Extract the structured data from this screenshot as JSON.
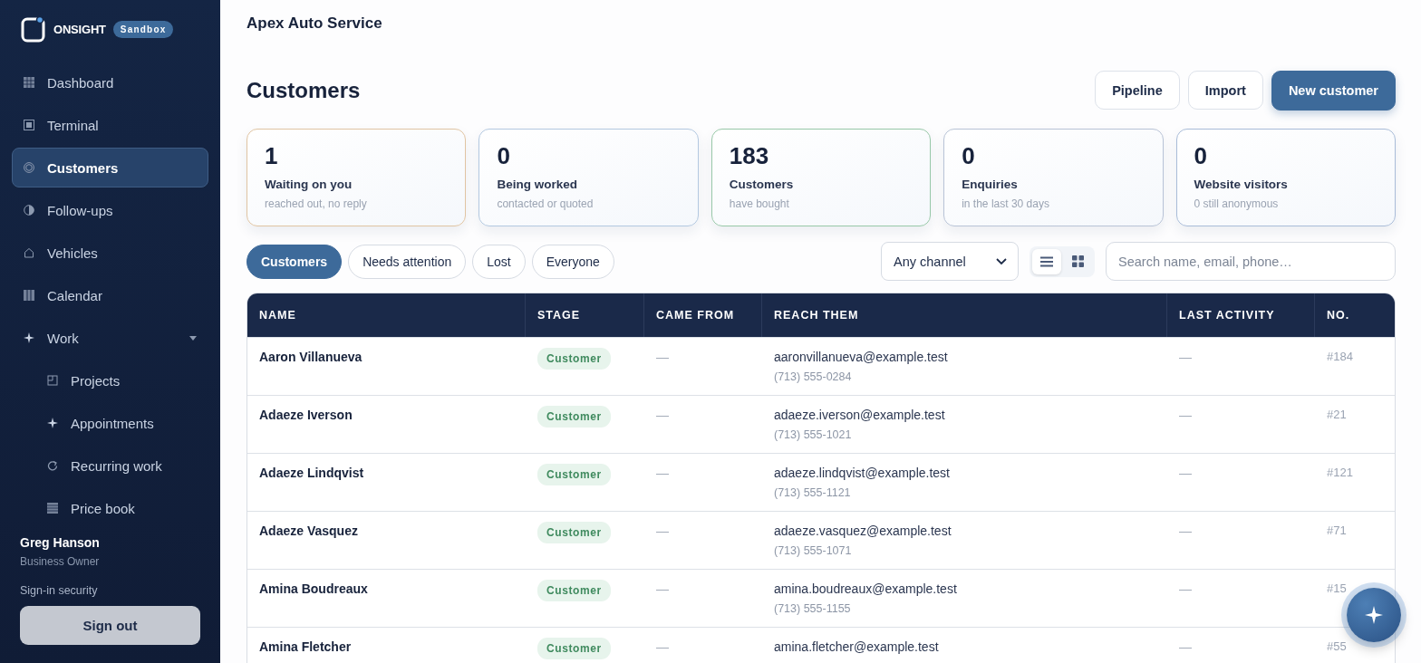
{
  "sidebar": {
    "logo": "ONSIGHT",
    "badge": "Sandbox",
    "items": [
      {
        "label": "Dashboard",
        "kind": "grid",
        "selected": false
      },
      {
        "label": "Terminal",
        "kind": "square",
        "selected": false
      },
      {
        "label": "Customers",
        "kind": "rings",
        "selected": true
      },
      {
        "label": "Follow-ups",
        "kind": "half",
        "selected": false
      },
      {
        "label": "Vehicles",
        "kind": "house",
        "selected": false
      },
      {
        "label": "Calendar",
        "kind": "columns",
        "selected": false
      },
      {
        "label": "Work",
        "kind": "sparkle",
        "selected": false,
        "expanded": true,
        "children": [
          {
            "label": "Projects",
            "kind": "frame",
            "selected": false
          },
          {
            "label": "Appointments",
            "kind": "sparkle",
            "selected": false
          },
          {
            "label": "Recurring work",
            "kind": "refresh",
            "selected": false
          },
          {
            "label": "Price book",
            "kind": "list",
            "selected": false
          }
        ]
      }
    ],
    "user": {
      "name": "Greg Hanson",
      "role": "Business Owner"
    },
    "security_link": "Sign-in security",
    "sign_out": "Sign out"
  },
  "business": "Apex Auto Service",
  "page_title": "Customers",
  "actions": [
    {
      "label": "Pipeline",
      "kind": "secondary"
    },
    {
      "label": "Import",
      "kind": "secondary"
    },
    {
      "label": "New customer",
      "kind": "primary"
    }
  ],
  "stats": [
    {
      "value": "1",
      "label": "Waiting on you",
      "note": "reached out, no reply",
      "color": "#e0c4a2"
    },
    {
      "value": "0",
      "label": "Being worked",
      "note": "contacted or quoted",
      "color": "#b3c8e0"
    },
    {
      "value": "183",
      "label": "Customers",
      "note": "have bought",
      "color": "#98c8a8"
    },
    {
      "value": "0",
      "label": "Enquiries",
      "note": "in the last 30 days",
      "color": "#b8c3d6"
    },
    {
      "value": "0",
      "label": "Website visitors",
      "note": "0 still anonymous",
      "color": "#a9bcd8"
    }
  ],
  "filters": [
    {
      "label": "Customers",
      "selected": true
    },
    {
      "label": "Needs attention",
      "selected": false
    },
    {
      "label": "Lost",
      "selected": false
    },
    {
      "label": "Everyone",
      "selected": false
    }
  ],
  "channel_select": "Any channel",
  "views": [
    {
      "kind": "list",
      "selected": true
    },
    {
      "kind": "grid",
      "selected": false
    }
  ],
  "search": {
    "placeholder": "Search name, email, phone…"
  },
  "table": {
    "columns": [
      "NAME",
      "STAGE",
      "CAME FROM",
      "REACH THEM",
      "LAST ACTIVITY",
      "NO."
    ],
    "rows": [
      {
        "name": "Aaron Villanueva",
        "stage": "Customer",
        "came_from": "—",
        "email": "aaronvillanueva@example.test",
        "phone": "(713) 555-0284",
        "last_activity": "—",
        "number": "#184"
      },
      {
        "name": "Adaeze Iverson",
        "stage": "Customer",
        "came_from": "—",
        "email": "adaeze.iverson@example.test",
        "phone": "(713) 555-1021",
        "last_activity": "—",
        "number": "#21"
      },
      {
        "name": "Adaeze Lindqvist",
        "stage": "Customer",
        "came_from": "—",
        "email": "adaeze.lindqvist@example.test",
        "phone": "(713) 555-1121",
        "last_activity": "—",
        "number": "#121"
      },
      {
        "name": "Adaeze Vasquez",
        "stage": "Customer",
        "came_from": "—",
        "email": "adaeze.vasquez@example.test",
        "phone": "(713) 555-1071",
        "last_activity": "—",
        "number": "#71"
      },
      {
        "name": "Amina Boudreaux",
        "stage": "Customer",
        "came_from": "—",
        "email": "amina.boudreaux@example.test",
        "phone": "(713) 555-1155",
        "last_activity": "—",
        "number": "#15"
      },
      {
        "name": "Amina Fletcher",
        "stage": "Customer",
        "came_from": "—",
        "email": "amina.fletcher@example.test",
        "last_activity": "—",
        "number": "#55"
      }
    ]
  }
}
